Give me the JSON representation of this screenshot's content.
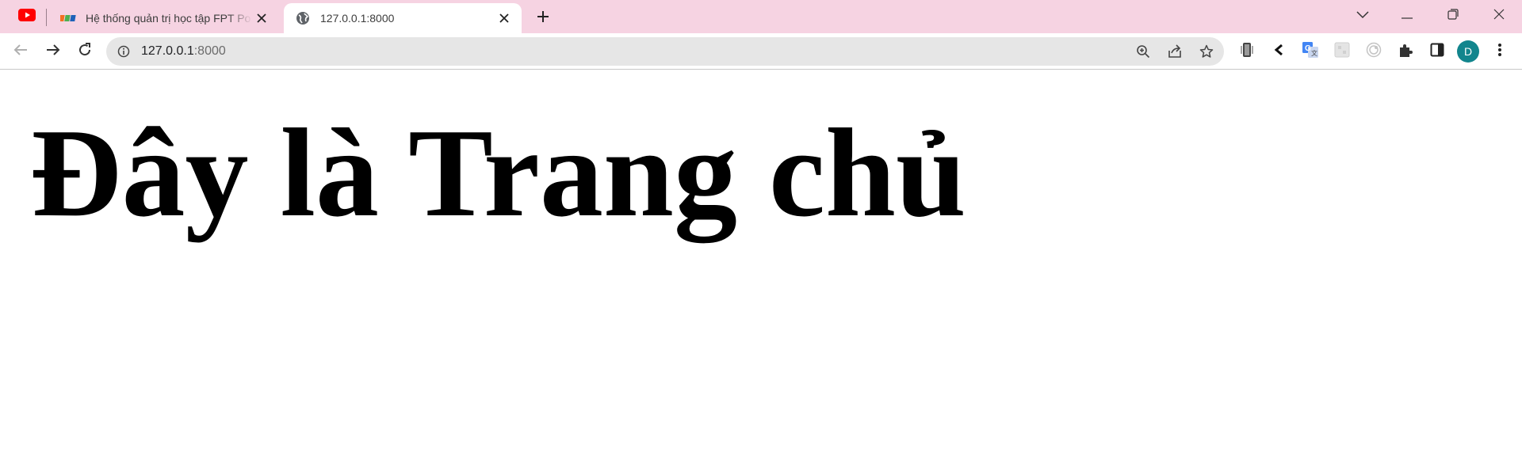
{
  "colors": {
    "tabstrip_bg": "#f6d3e2",
    "omnibox_bg": "#e6e6e6",
    "avatar_bg": "#12858d",
    "youtube_red": "#ff0000"
  },
  "tabs": [
    {
      "favicon": "youtube-icon",
      "pinned": true
    },
    {
      "favicon": "fpt-logo-icon",
      "title": "Hệ thống quản trị học tập FPT Po",
      "active": false
    },
    {
      "favicon": "globe-icon",
      "title": "127.0.0.1:8000",
      "active": true
    }
  ],
  "address_bar": {
    "host": "127.0.0.1",
    "port": ":8000"
  },
  "profile": {
    "initial": "D"
  },
  "page": {
    "heading": "Đây là Trang chủ"
  }
}
